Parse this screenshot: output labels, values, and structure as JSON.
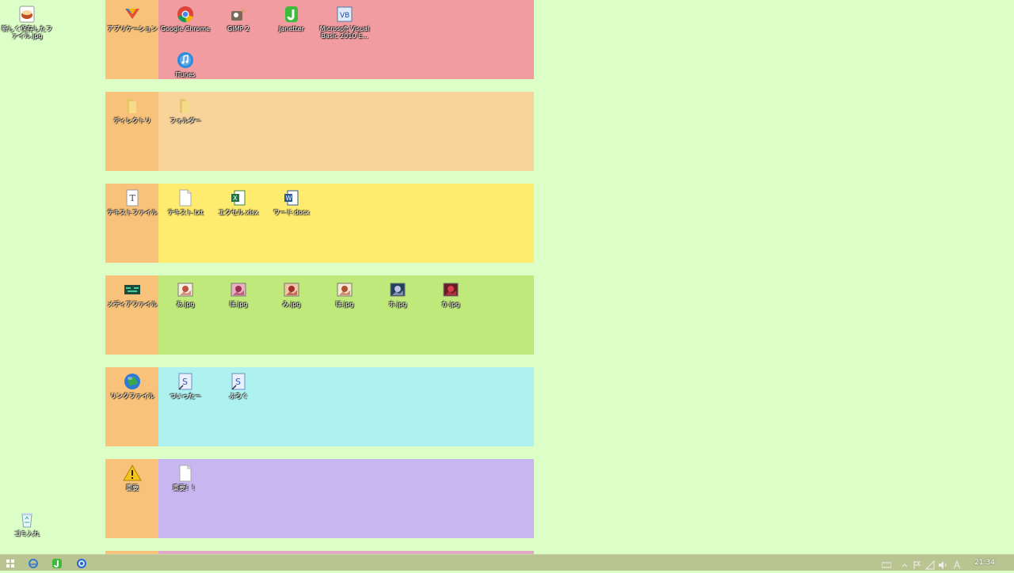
{
  "desktop": {
    "left_icons": [
      {
        "label": "新しく保存したファイル.jpg",
        "icon": "image-file-icon"
      },
      {
        "label": "ゴミ入れ",
        "icon": "recycle-bin-icon"
      }
    ]
  },
  "sections": [
    {
      "color": "#f09ca0",
      "category": {
        "label": "アプリケーション",
        "icon": "application-icon"
      },
      "items": [
        {
          "label": "Google Chrome",
          "icon": "chrome-icon"
        },
        {
          "label": "GIMP 2",
          "icon": "gimp-icon"
        },
        {
          "label": "Janetter",
          "icon": "janetter-icon"
        },
        {
          "label": "Microsoft Visual Basic 2010 E...",
          "icon": "visual-basic-icon"
        },
        {
          "label": "iTunes",
          "icon": "itunes-icon"
        }
      ]
    },
    {
      "color": "#f9d49a",
      "category": {
        "label": "ディレクトリ",
        "icon": "folder-icon"
      },
      "items": [
        {
          "label": "フォルダー",
          "icon": "folder-icon"
        }
      ]
    },
    {
      "color": "#ffeb6e",
      "category": {
        "label": "テキストファイル",
        "icon": "text-file-icon"
      },
      "items": [
        {
          "label": "テキスト.txt",
          "icon": "text-document-icon"
        },
        {
          "label": "エクセル.xlsx",
          "icon": "excel-icon"
        },
        {
          "label": "ワード.docx",
          "icon": "word-icon"
        }
      ]
    },
    {
      "color": "#bfe97a",
      "category": {
        "label": "メディアファイル",
        "icon": "media-icon"
      },
      "items": [
        {
          "label": "あ.jpg",
          "icon": "photo-icon"
        },
        {
          "label": "ほ.jpg",
          "icon": "photo-icon"
        },
        {
          "label": "み.jpg",
          "icon": "photo-icon"
        },
        {
          "label": "ほ.jpg",
          "icon": "photo-icon"
        },
        {
          "label": "ホ.jpg",
          "icon": "photo-icon"
        },
        {
          "label": "か.jpg",
          "icon": "photo-icon"
        }
      ]
    },
    {
      "color": "#aef2f0",
      "category": {
        "label": "リンクファイル",
        "icon": "globe-icon"
      },
      "items": [
        {
          "label": "ついったー",
          "icon": "link-icon"
        },
        {
          "label": "ぶろぐ",
          "icon": "link-icon"
        }
      ]
    },
    {
      "color": "#c8b6f0",
      "category": {
        "label": "重要",
        "icon": "warning-icon"
      },
      "items": [
        {
          "label": "重要！！",
          "icon": "blank-document-icon"
        }
      ]
    },
    {
      "color": "#e2a6c8",
      "category": {
        "label": "",
        "icon": ""
      },
      "items": []
    }
  ],
  "taskbar": {
    "buttons": [
      {
        "icon": "start-icon"
      },
      {
        "icon": "internet-explorer-icon"
      },
      {
        "icon": "janetter-icon"
      },
      {
        "icon": "browser-icon"
      }
    ],
    "tray": [
      {
        "icon": "keyboard-icon"
      },
      {
        "icon": "chevron-up-icon"
      },
      {
        "icon": "flag-icon"
      },
      {
        "icon": "network-icon"
      },
      {
        "icon": "speaker-icon"
      },
      {
        "icon": "ime-icon"
      }
    ],
    "clock": "21:34"
  }
}
